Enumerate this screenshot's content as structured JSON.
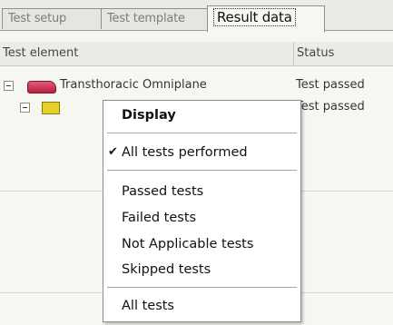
{
  "tabs": [
    {
      "label": "Test setup",
      "active": false
    },
    {
      "label": "Test template",
      "active": false
    },
    {
      "label": "Result data",
      "active": true
    }
  ],
  "table": {
    "columns": [
      "Test element",
      "Status"
    ],
    "rows": [
      {
        "label": "Transthoracic Omniplane",
        "status": "Test passed",
        "icon": "probe-icon"
      },
      {
        "label": "",
        "status": "Test passed",
        "icon": "test-element-icon"
      }
    ]
  },
  "context_menu": {
    "items": [
      {
        "label": "Display",
        "bold": true
      },
      {
        "label": "All tests performed",
        "checked": true
      },
      {
        "label": "Passed tests"
      },
      {
        "label": "Failed tests"
      },
      {
        "label": "Not Applicable tests"
      },
      {
        "label": "Skipped tests"
      },
      {
        "label": "All tests"
      }
    ]
  }
}
